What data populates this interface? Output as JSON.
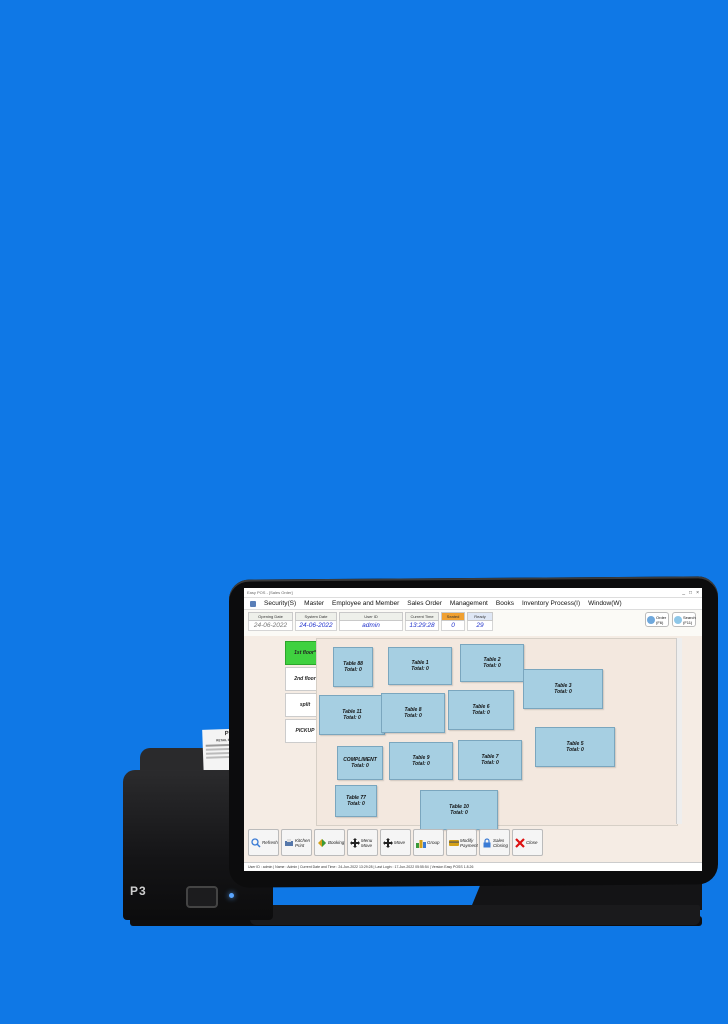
{
  "receipt": {
    "brand": "P3",
    "subtitle": "RETAIL PRINTER"
  },
  "printer": {
    "logo": "P3"
  },
  "window": {
    "title": "Easy POS - [Sales Order]",
    "controls": [
      "_",
      "□",
      "×"
    ]
  },
  "menu": [
    "Security(S)",
    "Master",
    "Employee and Member",
    "Sales Order",
    "Management",
    "Books",
    "Inventory Process(I)",
    "Window(W)"
  ],
  "info": [
    {
      "label": "Opening Date",
      "value": "24-06-2022",
      "style": "normal"
    },
    {
      "label": "System Date",
      "value": "24-06-2022",
      "style": "normal"
    },
    {
      "label": "User ID",
      "value": "admin",
      "style": "normal"
    },
    {
      "label": "Current Time",
      "value": "13:29:28",
      "style": "normal"
    },
    {
      "label": "Seated",
      "value": "0",
      "style": "seated"
    },
    {
      "label": "Ready",
      "value": "29",
      "style": "ready"
    }
  ],
  "top_buttons": [
    {
      "label": "Order (F6)",
      "icon": "order-icon"
    },
    {
      "label": "Search (F11)",
      "icon": "search-icon"
    }
  ],
  "floors": [
    {
      "label": "1st floor*",
      "active": true
    },
    {
      "label": "2nd floor",
      "active": false
    },
    {
      "label": "split",
      "active": false
    },
    {
      "label": "PICKUP",
      "active": false
    }
  ],
  "tables": [
    {
      "name": "Table 88",
      "total": "Total: 0"
    },
    {
      "name": "Table 1",
      "total": "Total: 0"
    },
    {
      "name": "Table 2",
      "total": "Total: 0"
    },
    {
      "name": "Table 3",
      "total": "Total: 0"
    },
    {
      "name": "Table 11",
      "total": "Total: 0"
    },
    {
      "name": "Table 8",
      "total": "Total: 0"
    },
    {
      "name": "Table 6",
      "total": "Total: 0"
    },
    {
      "name": "COMPLIMENT",
      "total": "Total: 0"
    },
    {
      "name": "Table 9",
      "total": "Total: 0"
    },
    {
      "name": "Table 7",
      "total": "Total: 0"
    },
    {
      "name": "Table 5",
      "total": "Total: 0"
    },
    {
      "name": "Table 77",
      "total": "Total: 0"
    },
    {
      "name": "Table 10",
      "total": "Total: 0"
    }
  ],
  "toolbar": [
    {
      "label": "Refresh",
      "icon": "refresh-icon",
      "color": "#3a7bd5"
    },
    {
      "label": "Kitchen Print",
      "icon": "printer-icon",
      "color": "#5577aa"
    },
    {
      "label": "Booking",
      "icon": "booking-icon",
      "color": "#d4a017"
    },
    {
      "label": "Menu Move",
      "icon": "move-arrows-icon",
      "color": "#222222"
    },
    {
      "label": "Move",
      "icon": "move-arrows-icon",
      "color": "#222222"
    },
    {
      "label": "Group",
      "icon": "group-icon",
      "color": "#3a9a3a"
    },
    {
      "label": "Modify Payment",
      "icon": "payment-icon",
      "color": "#d4a017"
    },
    {
      "label": "Sales Closing",
      "icon": "lock-icon",
      "color": "#3a7bd5"
    },
    {
      "label": "Close",
      "icon": "close-icon",
      "color": "#dd1111"
    }
  ],
  "status": "User ID : admin | Name : Admin | Current Date and Time : 24-Jun-2022 13:29:28 | Last Login : 17-Jun-2022 05:55:54 | Version Easy POSS 1.8.26"
}
